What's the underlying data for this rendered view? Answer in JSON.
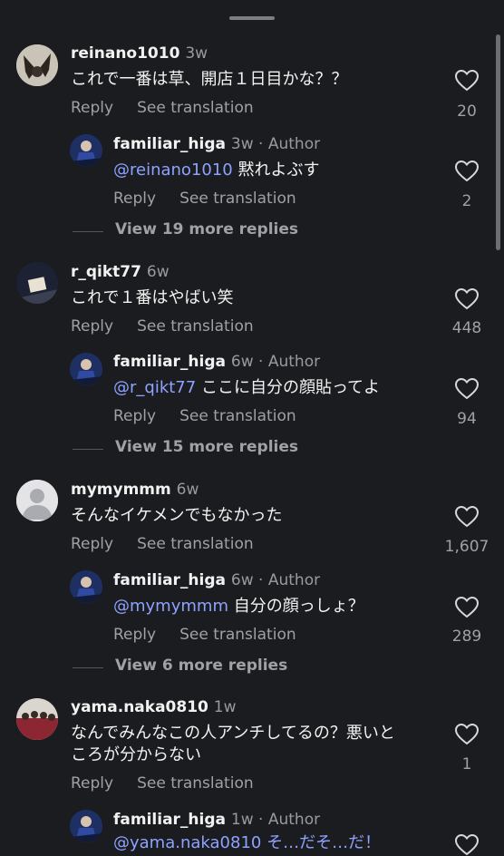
{
  "comments": [
    {
      "username": "reinano1010",
      "age": "3w",
      "text": "これで一番は草、開店１日目かな？？",
      "reply_label": "Reply",
      "translate_label": "See translation",
      "likes": "20",
      "reply": {
        "username": "familiar_higa",
        "meta": "3w · Author",
        "mention": "@reinano1010",
        "text": " 黙れよぶす",
        "reply_label": "Reply",
        "translate_label": "See translation",
        "likes": "2"
      },
      "view_more": "View 19 more replies"
    },
    {
      "username": "r_qikt77",
      "age": "6w",
      "text": "これで１番はやばい笑",
      "reply_label": "Reply",
      "translate_label": "See translation",
      "likes": "448",
      "reply": {
        "username": "familiar_higa",
        "meta": "6w · Author",
        "mention": "@r_qikt77",
        "text": " ここに自分の顔貼ってよ",
        "reply_label": "Reply",
        "translate_label": "See translation",
        "likes": "94"
      },
      "view_more": "View 15 more replies"
    },
    {
      "username": "mymymmm",
      "age": "6w",
      "text": "そんなイケメンでもなかった",
      "reply_label": "Reply",
      "translate_label": "See translation",
      "likes": "1,607",
      "reply": {
        "username": "familiar_higa",
        "meta": "6w · Author",
        "mention": "@mymymmm",
        "text": " 自分の顔っしょ？",
        "reply_label": "Reply",
        "translate_label": "See translation",
        "likes": "289"
      },
      "view_more": "View 6 more replies"
    },
    {
      "username": "yama.naka0810",
      "age": "1w",
      "text_line1": "なんでみんなこの人アンチしてるの？悪いと",
      "text_line2": "ころが分からない",
      "reply_label": "Reply",
      "translate_label": "See translation",
      "likes": "1",
      "reply": {
        "username": "familiar_higa",
        "meta": "1w · Author",
        "text_partial": "@yama.naka0810 そ…だそ…だ！"
      }
    }
  ]
}
